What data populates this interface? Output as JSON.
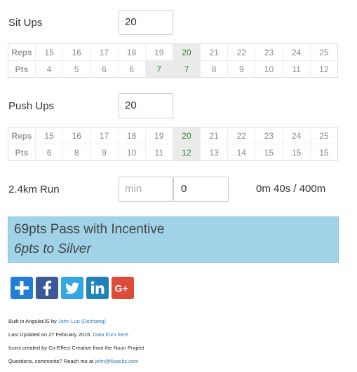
{
  "situps": {
    "label": "Sit Ups",
    "value": "20",
    "reps_header": "Reps",
    "pts_header": "Pts",
    "reps": [
      "15",
      "16",
      "17",
      "18",
      "19",
      "20",
      "21",
      "22",
      "23",
      "24",
      "25"
    ],
    "pts": [
      "4",
      "5",
      "6",
      "6",
      "7",
      "7",
      "8",
      "9",
      "10",
      "11",
      "12"
    ]
  },
  "pushups": {
    "label": "Push Ups",
    "value": "20",
    "reps_header": "Reps",
    "pts_header": "Pts",
    "reps": [
      "15",
      "16",
      "17",
      "18",
      "19",
      "20",
      "21",
      "22",
      "23",
      "24",
      "25"
    ],
    "pts": [
      "6",
      "8",
      "9",
      "10",
      "11",
      "12",
      "13",
      "14",
      "15",
      "15",
      "15"
    ]
  },
  "run": {
    "label": "2.4km Run",
    "min_placeholder": "min",
    "sec_value": "0",
    "pace": "0m 40s / 400m"
  },
  "result": {
    "line1": "69pts Pass with Incentive",
    "line2": "6pts to Silver"
  },
  "social": [
    {
      "name": "addthis",
      "color": "#1e7ed8",
      "icon": "plus-icon"
    },
    {
      "name": "facebook",
      "color": "#3b5998",
      "icon": "facebook-icon"
    },
    {
      "name": "twitter",
      "color": "#36a5e6",
      "icon": "twitter-icon"
    },
    {
      "name": "linkedin",
      "color": "#1f83b6",
      "icon": "linkedin-icon"
    },
    {
      "name": "googleplus",
      "color": "#dd4b39",
      "icon": "googleplus-icon"
    }
  ],
  "footer": {
    "built_prefix": "Built in AngularJS by ",
    "built_link": "John Luo (Dezhang)",
    "updated_prefix": "Last Updated on 27 February 2015. ",
    "updated_link": "Data from here.",
    "icons_credit": "Icons created by Co-Effect Creative from the Noun Project",
    "questions_prefix": "Questions, comments? Reach me at ",
    "questions_link": "john@6packs.com"
  },
  "colors": {
    "result_bg": "#a0d2e8",
    "highlight_text": "#2c8a2c",
    "highlight_bg": "#ebebeb",
    "link": "#2a7bbf"
  }
}
